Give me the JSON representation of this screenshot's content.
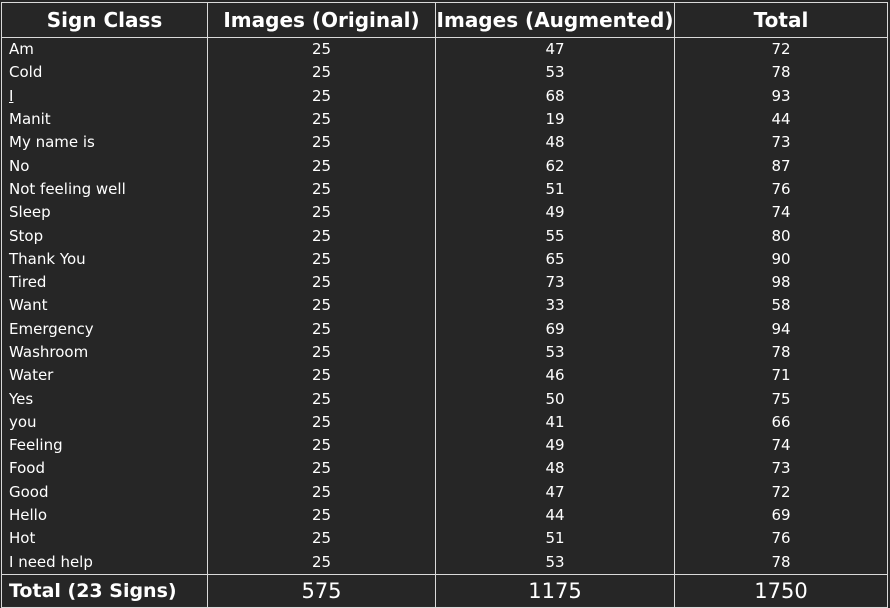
{
  "table": {
    "headers": [
      "Sign Class",
      "Images (Original)",
      "Images (Augmented)",
      "Total"
    ],
    "rows": [
      [
        "Am",
        "25",
        "47",
        "72"
      ],
      [
        "Cold",
        "25",
        "53",
        "78"
      ],
      [
        "I",
        "25",
        "68",
        "93"
      ],
      [
        "Manit",
        "25",
        "19",
        "44"
      ],
      [
        "My name is",
        "25",
        "48",
        "73"
      ],
      [
        "No",
        "25",
        "62",
        "87"
      ],
      [
        "Not feeling well",
        "25",
        "51",
        "76"
      ],
      [
        "Sleep",
        "25",
        "49",
        "74"
      ],
      [
        "Stop",
        "25",
        "55",
        "80"
      ],
      [
        "Thank You",
        "25",
        "65",
        "90"
      ],
      [
        "Tired",
        "25",
        "73",
        "98"
      ],
      [
        "Want",
        "25",
        "33",
        "58"
      ],
      [
        "Emergency",
        "25",
        "69",
        "94"
      ],
      [
        "Washroom",
        "25",
        "53",
        "78"
      ],
      [
        "Water",
        "25",
        "46",
        "71"
      ],
      [
        "Yes",
        "25",
        "50",
        "75"
      ],
      [
        "you",
        "25",
        "41",
        "66"
      ],
      [
        "Feeling",
        "25",
        "49",
        "74"
      ],
      [
        "Food",
        "25",
        "48",
        "73"
      ],
      [
        "Good",
        "25",
        "47",
        "72"
      ],
      [
        "Hello",
        "25",
        "44",
        "69"
      ],
      [
        "Hot",
        "25",
        "51",
        "76"
      ],
      [
        "I need help",
        "25",
        "53",
        "78"
      ]
    ],
    "footer": [
      "Total (23 Signs)",
      "575",
      "1175",
      "1750"
    ]
  }
}
